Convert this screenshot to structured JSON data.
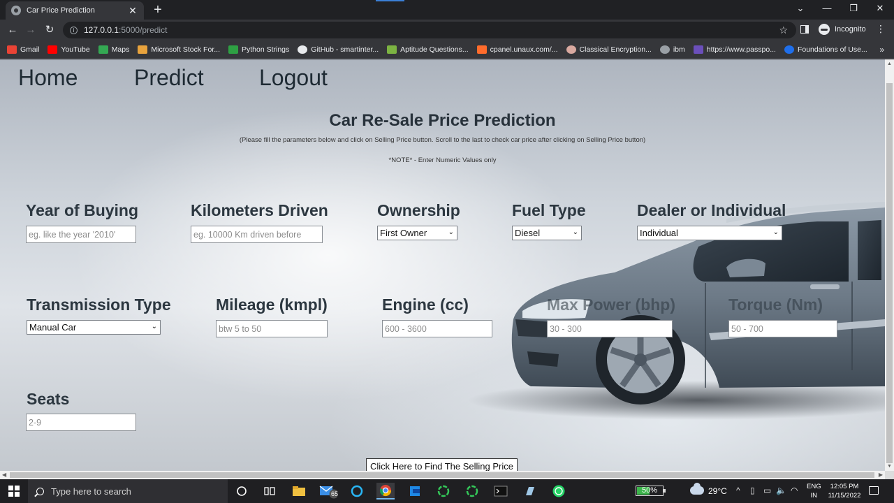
{
  "browser": {
    "tab_title": "Car Price Prediction",
    "tab_close": "✕",
    "new_tab": "+",
    "url_host": "127.0.0.1",
    "url_path": ":5000/predict",
    "incognito_label": "Incognito",
    "window_controls": [
      "⌄",
      "—",
      "❐",
      "✕"
    ],
    "bookmarks": [
      {
        "label": "Gmail",
        "icon": "gmail-icon",
        "color": "#ea4335"
      },
      {
        "label": "YouTube",
        "icon": "youtube-icon",
        "color": "#ff0000"
      },
      {
        "label": "Maps",
        "icon": "maps-icon",
        "color": "#34a853"
      },
      {
        "label": "Microsoft Stock For...",
        "icon": "stock-icon",
        "color": "#e8a33d"
      },
      {
        "label": "Python Strings",
        "icon": "w3-icon",
        "color": "#2ea043"
      },
      {
        "label": "GitHub - smartinter...",
        "icon": "github-icon",
        "color": "#e8eaed"
      },
      {
        "label": "Aptitude Questions...",
        "icon": "aptitude-icon",
        "color": "#7cb342"
      },
      {
        "label": "cpanel.unaux.com/...",
        "icon": "cpanel-icon",
        "color": "#ff6c2c"
      },
      {
        "label": "Classical Encryption...",
        "icon": "encryption-icon",
        "color": "#d9a9a0"
      },
      {
        "label": "ibm",
        "icon": "globe-icon",
        "color": "#9aa0a6"
      },
      {
        "label": "https://www.passpo...",
        "icon": "passport-icon",
        "color": "#6b4fbb"
      },
      {
        "label": "Foundations of Use...",
        "icon": "coursera-icon",
        "color": "#1f6feb"
      }
    ],
    "bookmarks_more": "»"
  },
  "page": {
    "nav": {
      "home": "Home",
      "predict": "Predict",
      "logout": "Logout"
    },
    "title": "Car Re-Sale Price Prediction",
    "subtitle": "(Please fill the parameters below and click on Selling Price button. Scroll to the last to check car price after clicking on Selling Price button)",
    "note": "*NOTE* - Enter Numeric Values only",
    "fields": {
      "year": {
        "label": "Year of Buying",
        "placeholder": "eg. like the year '2010'"
      },
      "km": {
        "label": "Kilometers Driven",
        "placeholder": "eg. 10000 Km driven before"
      },
      "owner": {
        "label": "Ownership",
        "value": "First Owner"
      },
      "fuel": {
        "label": "Fuel Type",
        "value": "Diesel"
      },
      "seller": {
        "label": "Dealer or Individual",
        "value": "Individual"
      },
      "transmission": {
        "label": "Transmission Type",
        "value": "Manual Car"
      },
      "mileage": {
        "label": "Mileage (kmpl)",
        "placeholder": "btw 5 to 50"
      },
      "engine": {
        "label": "Engine (cc)",
        "placeholder": "600 - 3600"
      },
      "power": {
        "label": "Max Power (bhp)",
        "placeholder": "30 - 300"
      },
      "torque": {
        "label": "Torque (Nm)",
        "placeholder": "50 - 700"
      },
      "seats": {
        "label": "Seats",
        "placeholder": "2-9"
      }
    },
    "submit_label": "Click Here to Find The Selling Price"
  },
  "taskbar": {
    "search_placeholder": "Type here to search",
    "mail_badge": "65",
    "battery_percent": "50%",
    "battery_level": 0.5,
    "temperature": "29°C",
    "lang_line1": "ENG",
    "lang_line2": "IN",
    "time": "12:05 PM",
    "date": "11/15/2022"
  }
}
